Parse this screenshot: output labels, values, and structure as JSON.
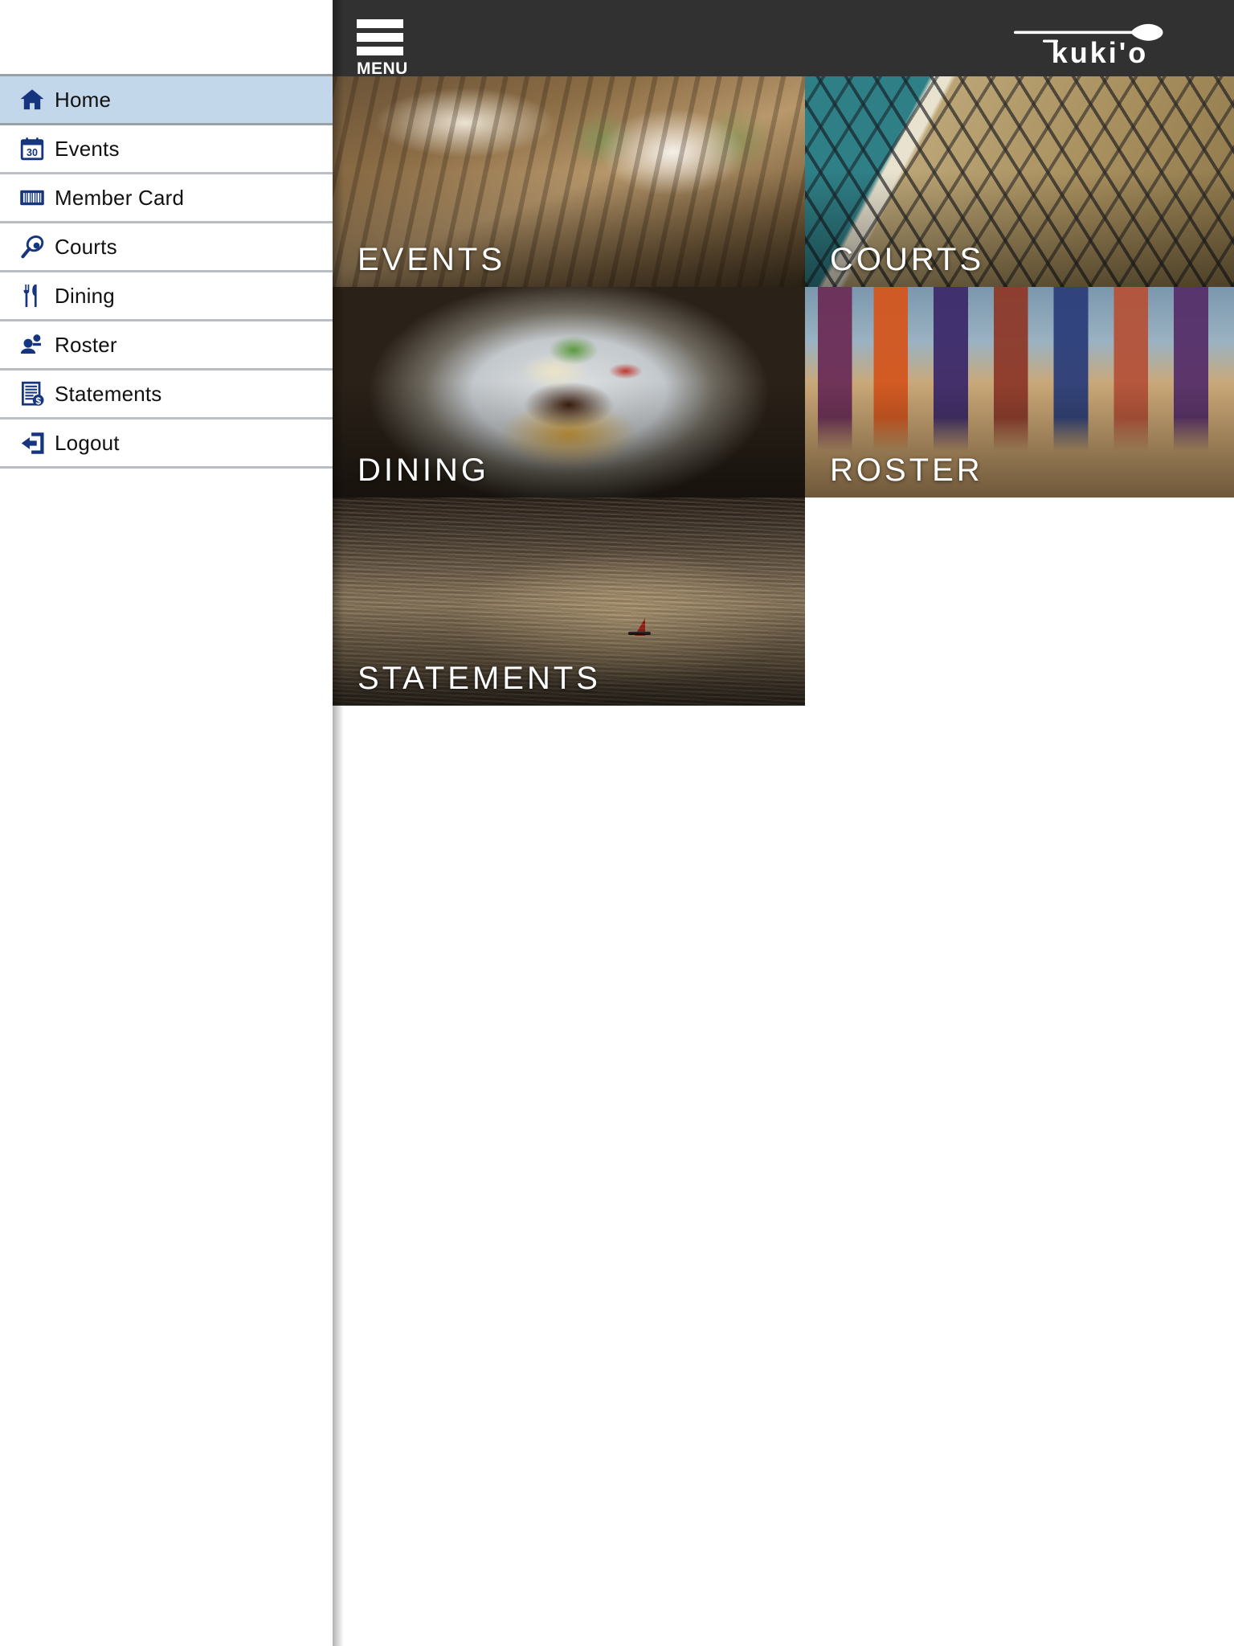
{
  "app": {
    "brand": "kūki'o",
    "brand_logo_alt": "kukio-paddle-logo"
  },
  "topbar": {
    "menu_label": "MENU",
    "hamburger_icon": "hamburger-menu-icon",
    "background_color": "#313131"
  },
  "sidebar": {
    "active_item": "Home",
    "active_background_color": "#c2d8ea",
    "icon_color": "#15357f",
    "items": [
      {
        "label": "Home",
        "icon": "home-icon",
        "active": true
      },
      {
        "label": "Events",
        "icon": "calendar-icon",
        "active": false
      },
      {
        "label": "Member Card",
        "icon": "barcode-icon",
        "active": false
      },
      {
        "label": "Courts",
        "icon": "racquet-icon",
        "active": false
      },
      {
        "label": "Dining",
        "icon": "cutlery-icon",
        "active": false
      },
      {
        "label": "Roster",
        "icon": "people-icon",
        "active": false
      },
      {
        "label": "Statements",
        "icon": "document-dollar-icon",
        "active": false
      },
      {
        "label": "Logout",
        "icon": "exit-arrow-icon",
        "active": false
      }
    ]
  },
  "main": {
    "tiles": [
      {
        "label": "EVENTS",
        "image": "banquet-tables-photo",
        "size": "large"
      },
      {
        "label": "COURTS",
        "image": "tennis-court-photo",
        "size": "side"
      },
      {
        "label": "DINING",
        "image": "plated-steak-photo",
        "size": "large"
      },
      {
        "label": "ROSTER",
        "image": "beach-legs-photo",
        "size": "side"
      },
      {
        "label": "STATEMENTS",
        "image": "lava-sailboat-photo",
        "size": "wide"
      }
    ]
  }
}
